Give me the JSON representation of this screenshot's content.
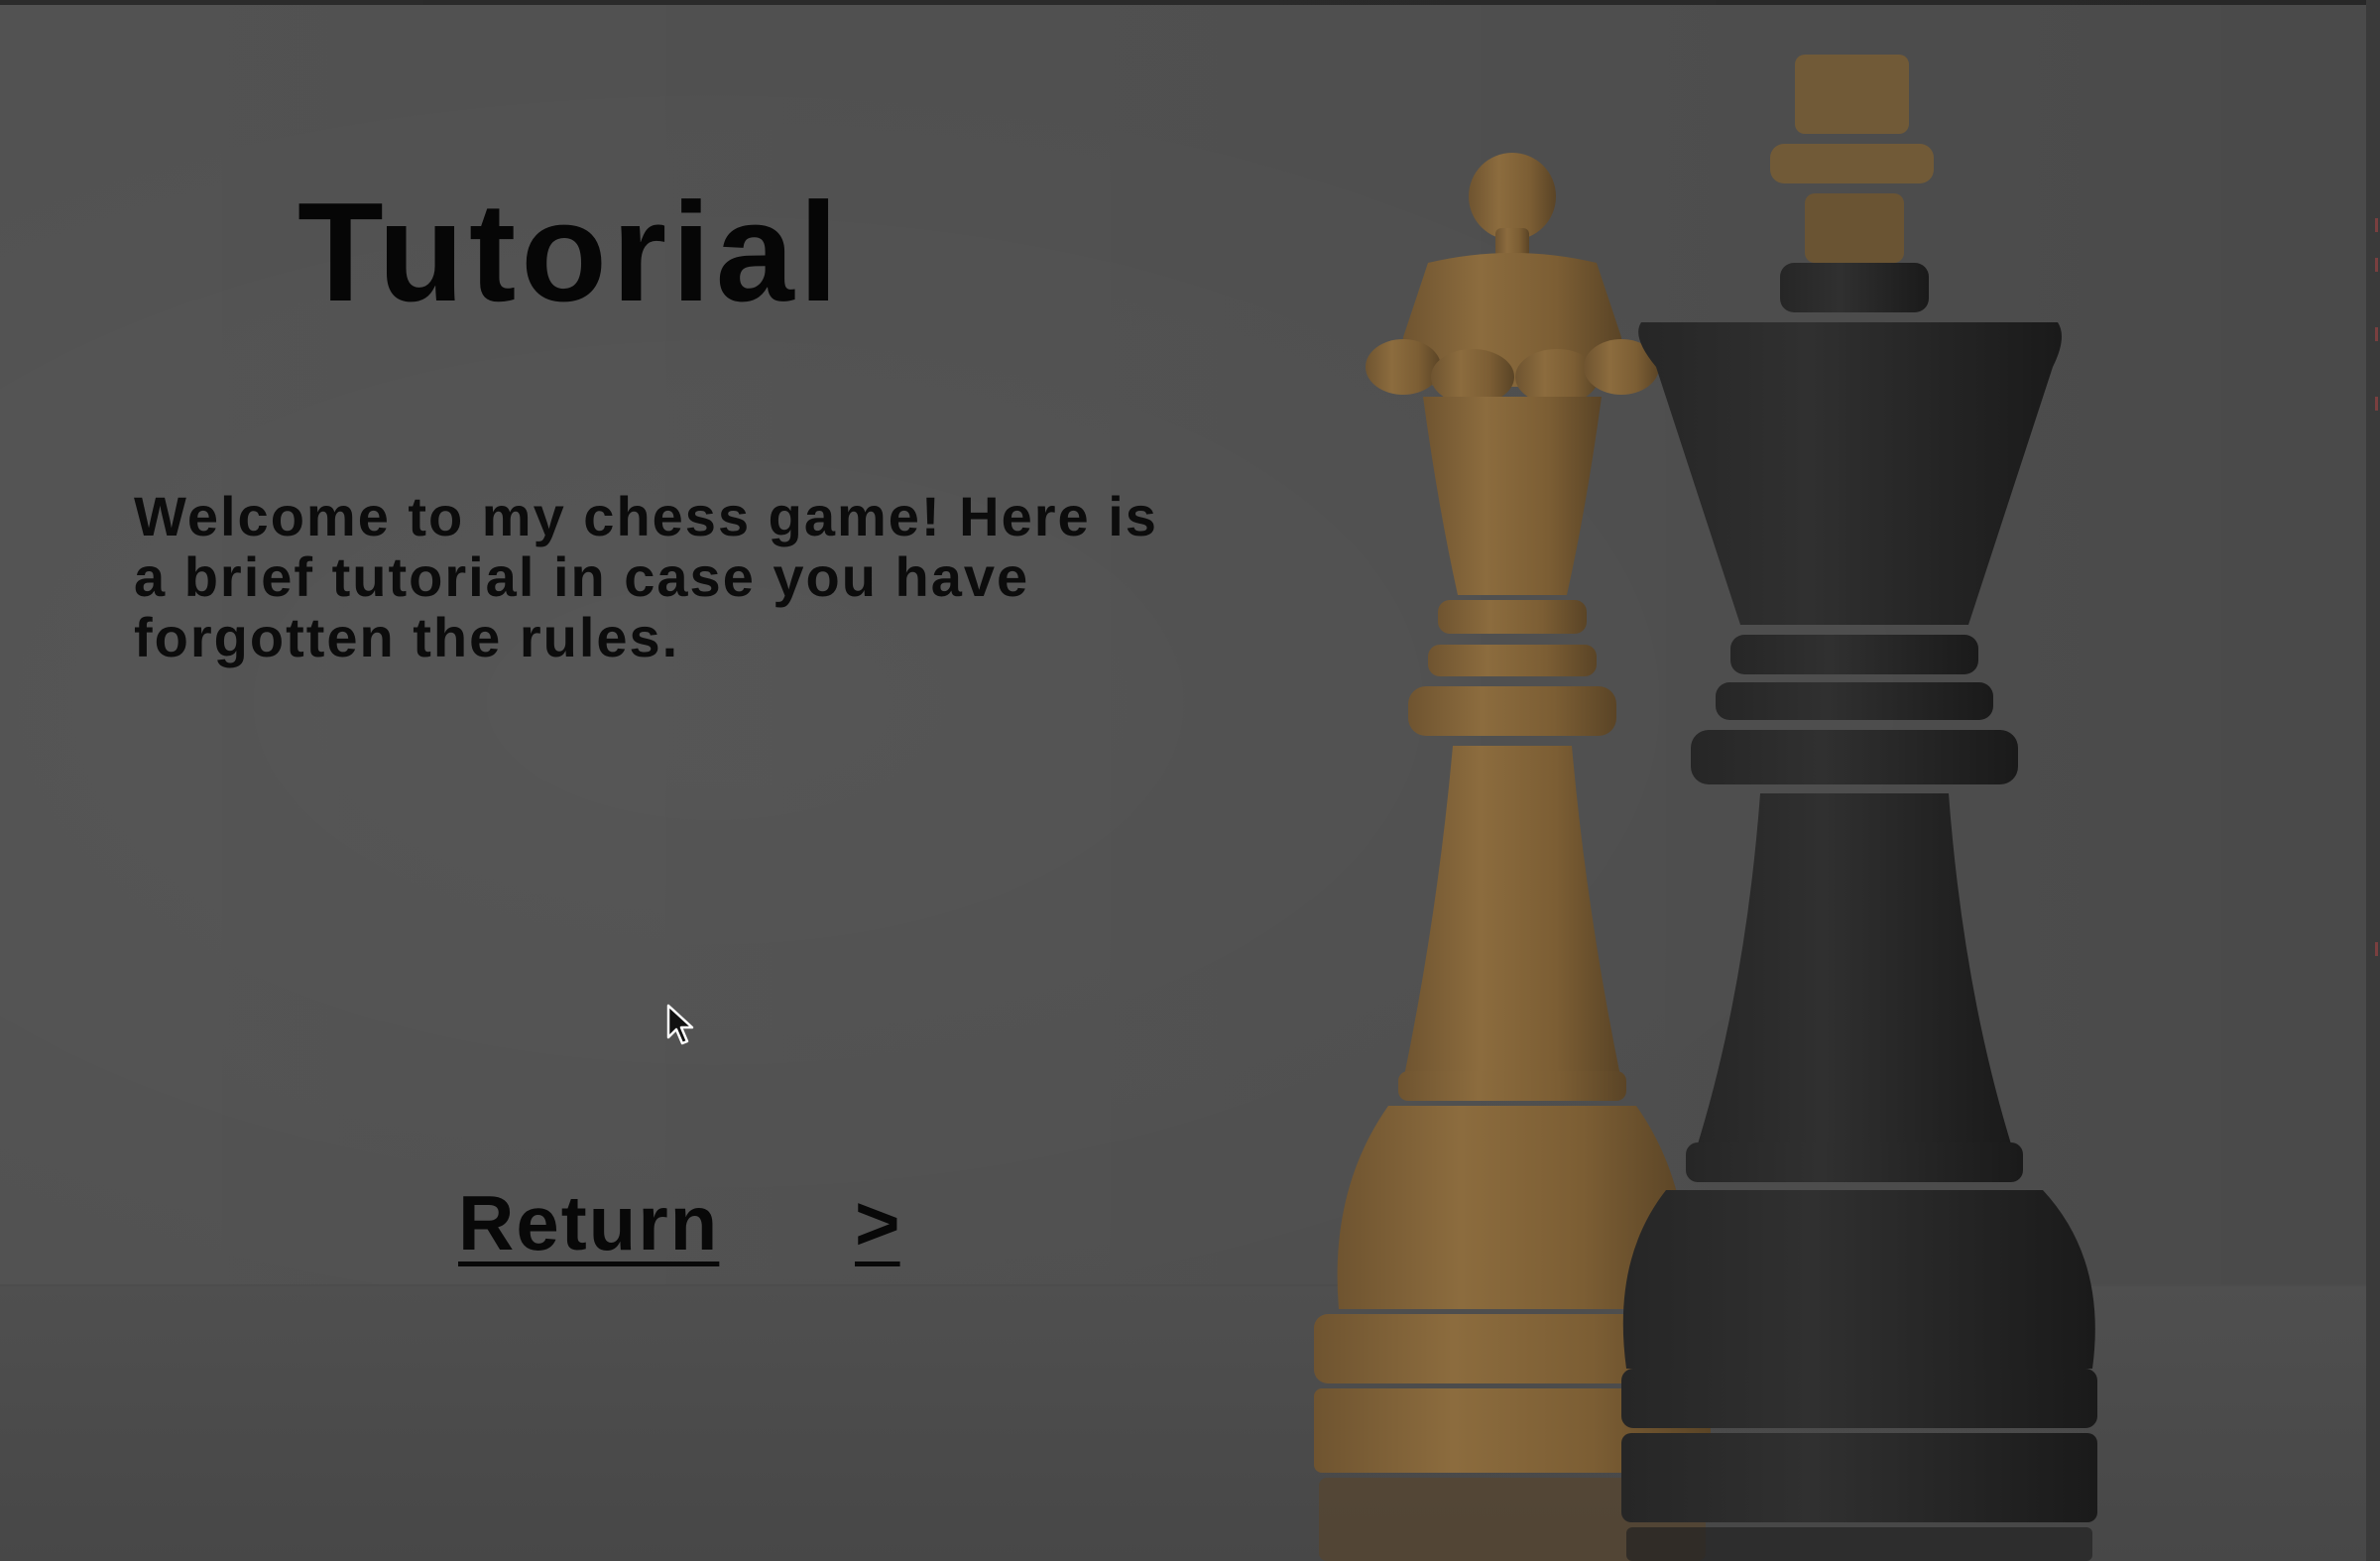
{
  "tutorial": {
    "title": "Tutorial",
    "welcome_text": "Welcome to my chess game! Here is a brief tutorial in case you have forgotten the rules.",
    "return_label": "Return",
    "next_label": ">"
  },
  "background": {
    "image_subject": "white queen and black king chess pieces",
    "queen_color": "#8a6a3c",
    "king_color": "#1f1f1f",
    "overlay_color": "#525252"
  },
  "cursor_icon": "arrow-cursor-icon"
}
